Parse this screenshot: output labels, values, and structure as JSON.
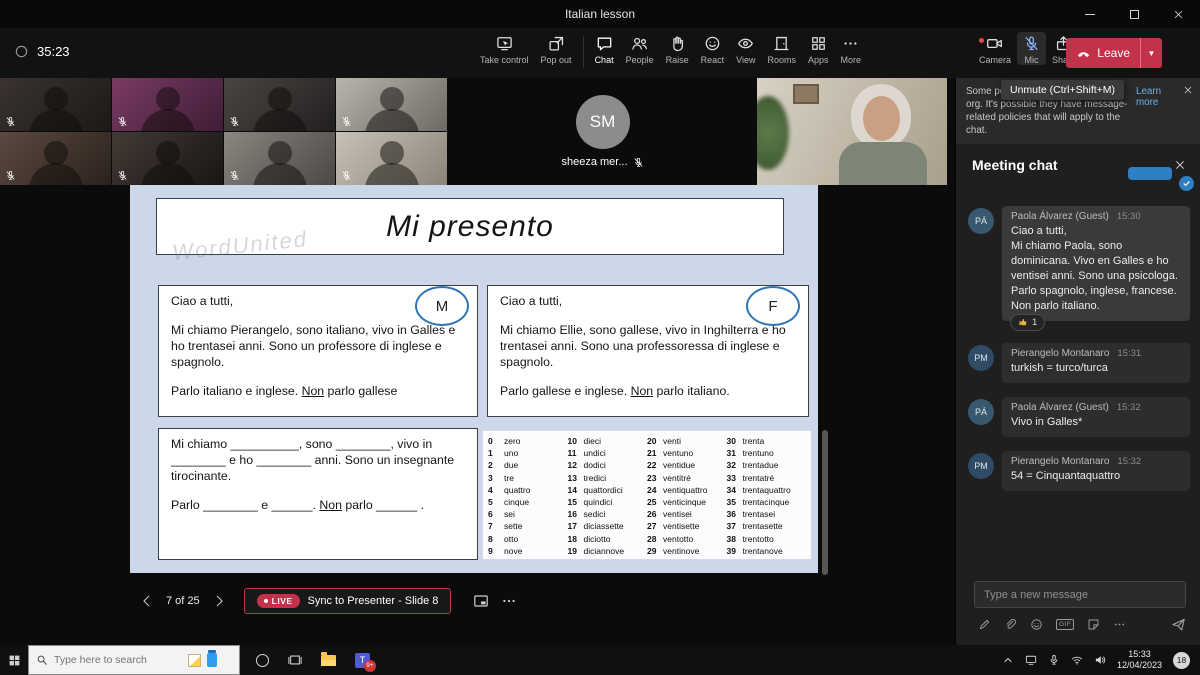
{
  "window": {
    "title": "Italian lesson"
  },
  "colors": {
    "leave_red": "#c4314b",
    "live_red": "#c4314b",
    "link_blue": "#71afe5",
    "slide_bg": "#ccd7ea",
    "badge_blue": "#2e75b6"
  },
  "toolbar": {
    "timer": "35:23",
    "buttons": [
      {
        "label": "Take control"
      },
      {
        "label": "Pop out"
      },
      {
        "label": "Chat"
      },
      {
        "label": "People"
      },
      {
        "label": "Raise"
      },
      {
        "label": "React"
      },
      {
        "label": "View"
      },
      {
        "label": "Rooms"
      },
      {
        "label": "Apps"
      },
      {
        "label": "More"
      },
      {
        "label": "Camera"
      },
      {
        "label": "Mic"
      },
      {
        "label": "Share"
      }
    ],
    "leave": {
      "label": "Leave"
    },
    "mic_tooltip": "Unmute (Ctrl+Shift+M)"
  },
  "stage": {
    "spotlight": {
      "initials": "SM",
      "name": "sheeza mer..."
    },
    "controls": {
      "page": "7 of 25",
      "live_badge": "LIVE",
      "sync_label": "Sync to Presenter - Slide 8"
    }
  },
  "slide": {
    "title": "Mi presento",
    "watermark": "WordUnited",
    "boxes": [
      {
        "badge": "M",
        "paras": [
          [
            {
              "t": "Ciao a tutti,"
            }
          ],
          [
            {
              "t": "Mi chiamo Pierangelo, sono italiano, vivo in Galles e ho trentasei anni. Sono un professore di inglese e spagnolo."
            }
          ],
          [
            {
              "t": "Parlo italiano e inglese. "
            },
            {
              "t": "Non",
              "u": true
            },
            {
              "t": " parlo gallese"
            }
          ]
        ]
      },
      {
        "badge": "F",
        "paras": [
          [
            {
              "t": "Ciao a tutti,"
            }
          ],
          [
            {
              "t": "Mi chiamo Ellie, sono gallese, vivo in Inghilterra e ho trentasei anni. Sono una professoressa di inglese e spagnolo."
            }
          ],
          [
            {
              "t": "Parlo gallese e inglese. "
            },
            {
              "t": "Non",
              "u": true
            },
            {
              "t": " parlo italiano."
            }
          ]
        ]
      },
      {
        "badge": "",
        "paras": [
          [
            {
              "t": "Mi chiamo __________, sono ________, vivo in ________ e ho ________ anni. Sono un insegnante tirocinante."
            }
          ],
          [
            {
              "t": "Parlo ________ e ______. "
            },
            {
              "t": "Non",
              "u": true
            },
            {
              "t": " parlo ______ ."
            }
          ]
        ]
      }
    ],
    "numbers": {
      "columns": [
        [
          [
            "0",
            "zero"
          ],
          [
            "1",
            "uno"
          ],
          [
            "2",
            "due"
          ],
          [
            "3",
            "tre"
          ],
          [
            "4",
            "quattro"
          ],
          [
            "5",
            "cinque"
          ],
          [
            "6",
            "sei"
          ],
          [
            "7",
            "sette"
          ],
          [
            "8",
            "otto"
          ],
          [
            "9",
            "nove"
          ]
        ],
        [
          [
            "10",
            "dieci"
          ],
          [
            "11",
            "undici"
          ],
          [
            "12",
            "dodici"
          ],
          [
            "13",
            "tredici"
          ],
          [
            "14",
            "quattordici"
          ],
          [
            "15",
            "quindici"
          ],
          [
            "16",
            "sedici"
          ],
          [
            "17",
            "diciassette"
          ],
          [
            "18",
            "diciotto"
          ],
          [
            "19",
            "diciannove"
          ]
        ],
        [
          [
            "20",
            "venti"
          ],
          [
            "21",
            "ventuno"
          ],
          [
            "22",
            "ventidue"
          ],
          [
            "23",
            "ventitré"
          ],
          [
            "24",
            "ventiquattro"
          ],
          [
            "25",
            "venticinque"
          ],
          [
            "26",
            "ventisei"
          ],
          [
            "27",
            "ventisette"
          ],
          [
            "28",
            "ventotto"
          ],
          [
            "29",
            "ventinove"
          ]
        ],
        [
          [
            "30",
            "trenta"
          ],
          [
            "31",
            "trentuno"
          ],
          [
            "32",
            "trentadue"
          ],
          [
            "33",
            "trentatré"
          ],
          [
            "34",
            "trentaquattro"
          ],
          [
            "35",
            "trentacinque"
          ],
          [
            "36",
            "trentasei"
          ],
          [
            "37",
            "trentasette"
          ],
          [
            "38",
            "trentotto"
          ],
          [
            "39",
            "trentanove"
          ]
        ]
      ]
    }
  },
  "chat": {
    "banner": {
      "fragment_left": "Some pe",
      "fragment_right": "e your org. It's possible they have message-related policies that will apply to the chat.",
      "link": "Learn more"
    },
    "header": "Meeting chat",
    "messages": [
      {
        "initials": "PÁ",
        "author": "Paola Álvarez (Guest)",
        "time": "15:30",
        "text": "Ciao a tutti,\nMi chiamo Paola, sono dominicana. Vivo en Galles e ho ventisei anni. Sono una psicologa. Parlo spagnolo, inglese, francese. Non parlo italiano.",
        "reaction_count": "1"
      },
      {
        "initials": "PM",
        "author": "Pierangelo Montanaro",
        "time": "15:31",
        "text": "turkish = turco/turca"
      },
      {
        "initials": "PÁ",
        "author": "Paola Álvarez (Guest)",
        "time": "15:32",
        "text": "Vivo in Galles*"
      },
      {
        "initials": "PM",
        "author": "Pierangelo Montanaro",
        "time": "15:32",
        "text": "54 = Cinquantaquattro"
      }
    ],
    "compose": {
      "placeholder": "Type a new message",
      "gif_label": "GIF"
    }
  },
  "taskbar": {
    "search_placeholder": "Type here to search",
    "teams_badge": "9+",
    "time": "15:33",
    "date": "12/04/2023",
    "tray_badge": "18"
  }
}
